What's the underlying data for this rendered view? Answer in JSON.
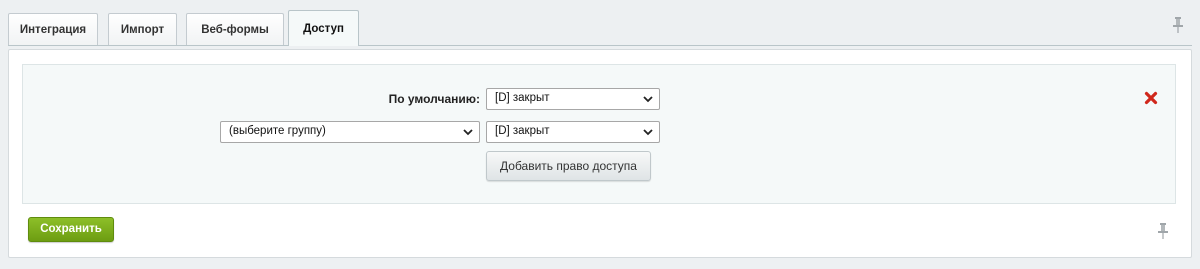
{
  "tabs": [
    {
      "label": "Интеграция",
      "active": false
    },
    {
      "label": "Импорт",
      "active": false
    },
    {
      "label": "Веб-формы",
      "active": false
    },
    {
      "label": "Доступ",
      "active": true
    }
  ],
  "access": {
    "default_label": "По умолчанию:",
    "default_value": "[D] закрыт",
    "group_select_value": "(выберите группу)",
    "group_access_value": "[D] закрыт",
    "add_button_label": "Добавить право доступа"
  },
  "footer": {
    "save_label": "Сохранить"
  },
  "icons": {
    "pin": "pin-icon",
    "delete": "delete-icon",
    "select_arrow": "chevron-down-icon"
  },
  "colors": {
    "save_button": "#7aad1c",
    "delete_icon": "#d0281c"
  }
}
